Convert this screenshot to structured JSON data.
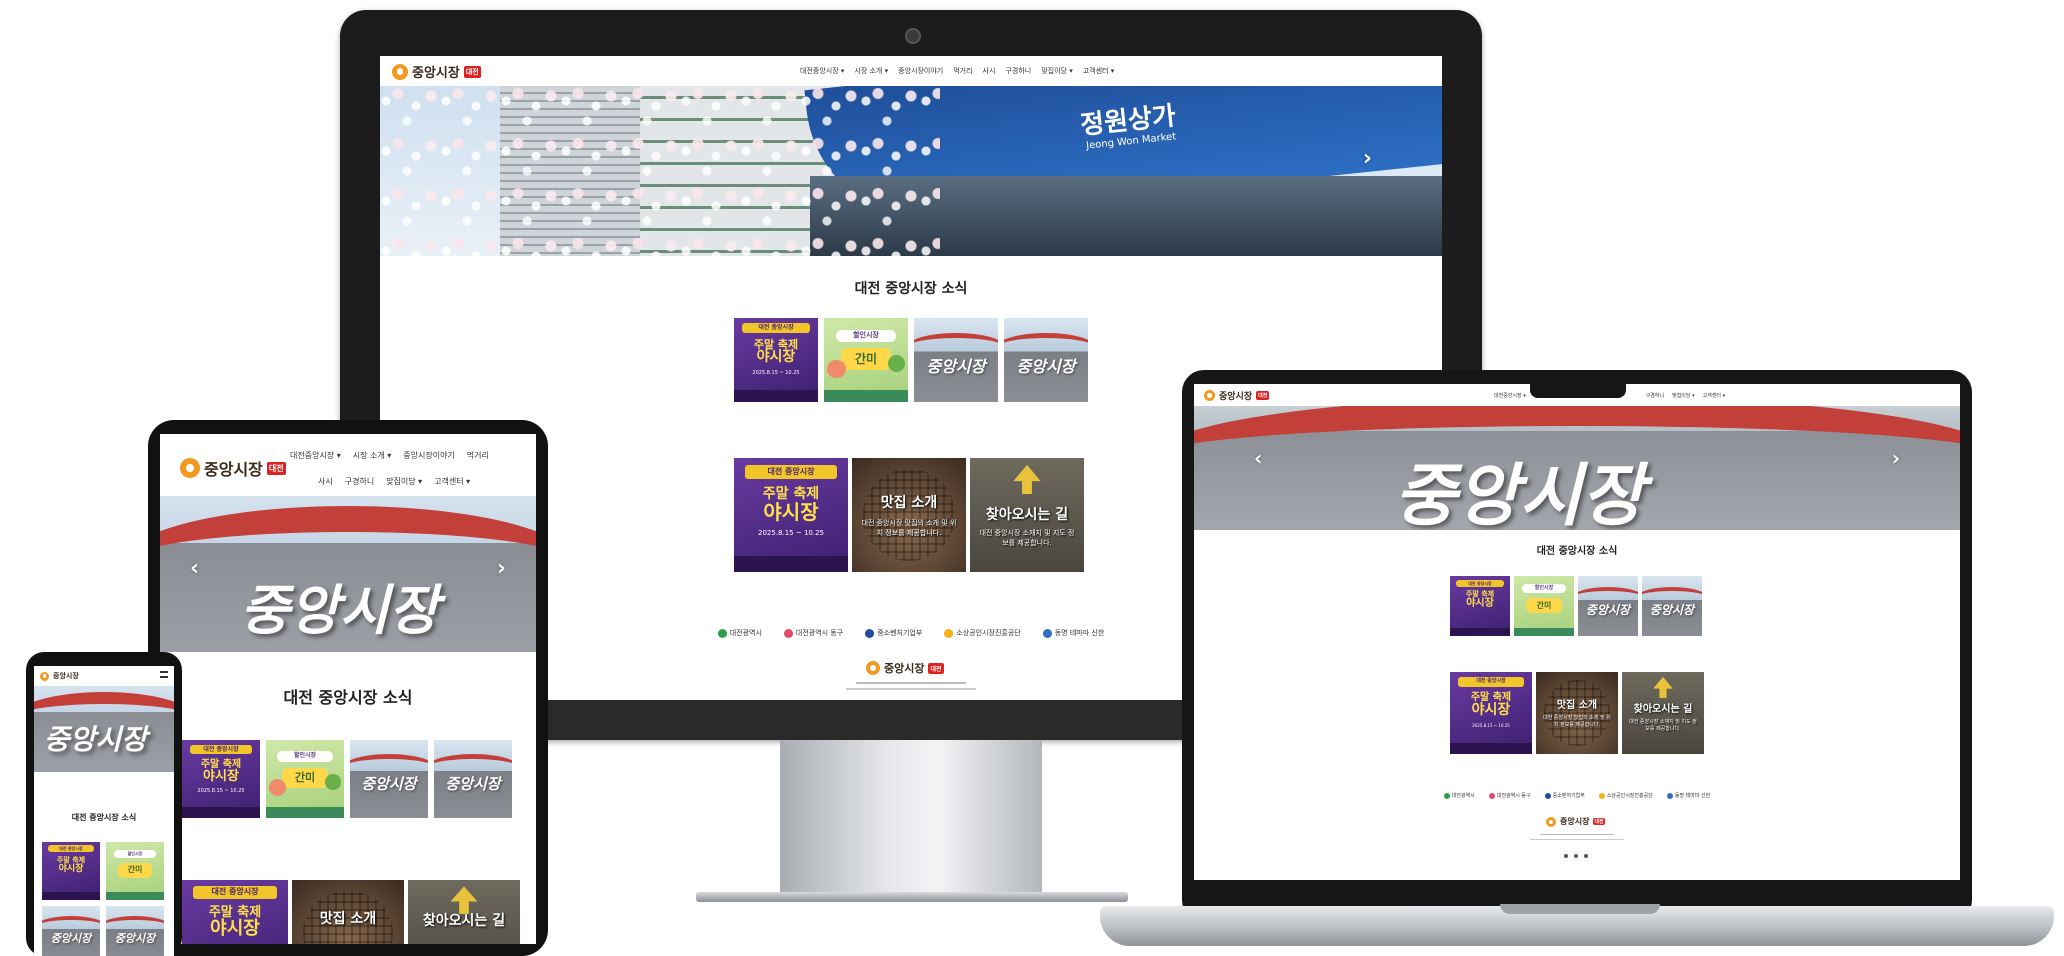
{
  "site": {
    "logo_text": "중앙시장",
    "logo_badge": "대전",
    "news_title": "대전 중앙시장 소식",
    "nav_desktop": [
      "대전중앙시장 ▾",
      "시장 소개 ▾",
      "중앙시장이야기",
      "먹거리",
      "사시",
      "구경하니",
      "맞집이당 ▾",
      "고객센터 ▾"
    ],
    "nav_tablet_row1": [
      "대전중앙시장 ▾",
      "시장 소개 ▾",
      "중앙시장이야기",
      "먹거리"
    ],
    "nav_tablet_row2": [
      "사시",
      "구경하니",
      "맞집이당 ▾",
      "고객센터 ▾"
    ],
    "nav_laptop": [
      "대전중앙시장 ▾",
      "구경하니",
      "맞집이당 ▾",
      "고객센터 ▾"
    ],
    "hero_monitor_sign": "정원상가",
    "hero_monitor_sign_en": "Jeong Won Market",
    "hero_lettering": "중앙시장",
    "festival": {
      "top": "대전 중앙시장",
      "main_line1": "주말 축제",
      "main_line2": "야시장",
      "sub": "2025.8.15 ~ 10.25"
    },
    "green_poster": {
      "top": "할인시장",
      "mid": "간미"
    },
    "tile_food_title": "맛집 소개",
    "tile_food_desc": "대전 중앙시장 맛집의 소개 및 위치 정보를 제공합니다.",
    "tile_road_title": "찾아오시는 길",
    "tile_road_desc": "대전 중앙시장 소재지 및 지도 정보를 제공합니다.",
    "partners": [
      "대전광역시",
      "대전광역시 동구",
      "중소벤처기업부",
      "소상공인시장진흥공단",
      "동명 테마마 신한"
    ],
    "menu_icon": "hamburger-icon",
    "chevron_left_icon": "chevron-left-icon",
    "chevron_right_icon": "chevron-right-icon"
  },
  "colors": {
    "bezel": "#1b1b1b",
    "silver": "#c9ccd0",
    "accent_orange": "#f29a1f",
    "accent_red": "#c3403a",
    "festival_purple": "#5a2f90"
  }
}
